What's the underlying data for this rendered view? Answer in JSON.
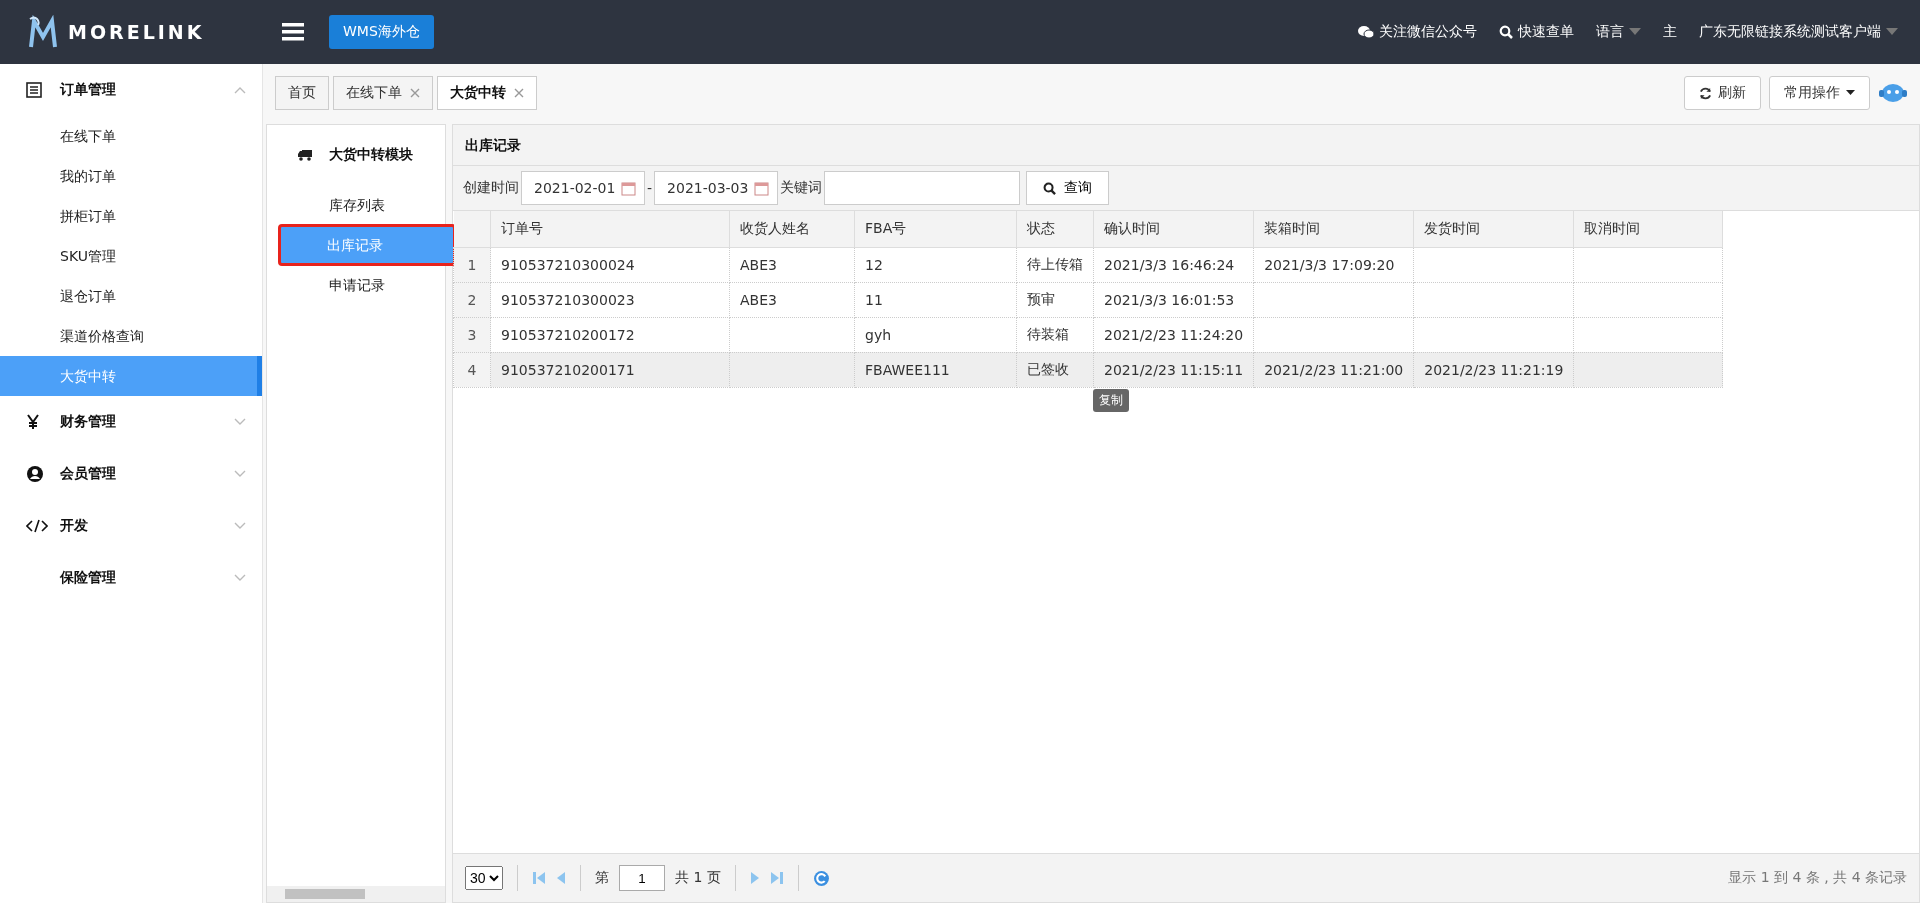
{
  "topbar": {
    "logo": "MORELINK",
    "app_button": "WMS海外仓",
    "links": [
      {
        "kind": "wechat",
        "label": "关注微信公众号"
      },
      {
        "kind": "search",
        "label": "快速查单"
      },
      {
        "kind": "dropdown",
        "label": "语言"
      },
      {
        "kind": "plain",
        "label": "主"
      },
      {
        "kind": "dropdown",
        "label": "广东无限链接系统测试客户端"
      }
    ]
  },
  "sidebar": {
    "groups": [
      {
        "kind": "list",
        "label": "订单管理",
        "expanded": true,
        "children": [
          {
            "label": "在线下单",
            "selected": false
          },
          {
            "label": "我的订单",
            "selected": false
          },
          {
            "label": "拼柜订单",
            "selected": false
          },
          {
            "label": "SKU管理",
            "selected": false
          },
          {
            "label": "退仓订单",
            "selected": false
          },
          {
            "label": "渠道价格查询",
            "selected": false
          },
          {
            "label": "大货中转",
            "selected": true
          }
        ]
      },
      {
        "kind": "finance",
        "label": "财务管理",
        "expanded": false
      },
      {
        "kind": "member",
        "label": "会员管理",
        "expanded": false
      },
      {
        "kind": "code",
        "label": "开发",
        "expanded": false
      },
      {
        "kind": "plain",
        "label": "保险管理",
        "expanded": false
      }
    ]
  },
  "tabs": [
    {
      "label": "首页",
      "selected": false,
      "closable": false
    },
    {
      "label": "在线下单",
      "selected": false,
      "closable": true
    },
    {
      "label": "大货中转",
      "selected": true,
      "closable": true
    }
  ],
  "toolbar": {
    "refresh": "刷新",
    "actions": "常用操作"
  },
  "module": {
    "title": "大货中转模块",
    "items": [
      {
        "label": "库存列表",
        "selected": false,
        "highlighted": false
      },
      {
        "label": "出库记录",
        "selected": true,
        "highlighted": true
      },
      {
        "label": "申请记录",
        "selected": false,
        "highlighted": false
      }
    ]
  },
  "panel": {
    "title": "出库记录",
    "filter": {
      "created_label": "创建时间",
      "date_from": "2021-02-01",
      "date_to": "2021-03-03",
      "separator": "-",
      "keyword_label": "关键词",
      "search_button": "查询"
    },
    "table": {
      "columns": [
        "订单号",
        "收货人姓名",
        "FBA号",
        "状态",
        "确认时间",
        "装箱时间",
        "发货时间",
        "取消时间"
      ],
      "rows": [
        {
          "index": "1",
          "selected": false,
          "cells": [
            "910537210300024",
            "ABE3",
            "12",
            "待上传箱",
            "2021/3/3 16:46:24",
            "2021/3/3 17:09:20",
            "",
            ""
          ]
        },
        {
          "index": "2",
          "selected": false,
          "cells": [
            "910537210300023",
            "ABE3",
            "11",
            "预审",
            "2021/3/3 16:01:53",
            "",
            "",
            ""
          ]
        },
        {
          "index": "3",
          "selected": false,
          "cells": [
            "910537210200172",
            "",
            "gyh",
            "待装箱",
            "2021/2/23 11:24:20",
            "",
            "",
            ""
          ]
        },
        {
          "index": "4",
          "selected": true,
          "cells": [
            "910537210200171",
            "",
            "FBAWEE111",
            "已签收",
            "2021/2/23 11:15:11",
            "2021/2/23 11:21:00",
            "2021/2/23 11:21:19",
            ""
          ]
        }
      ]
    },
    "tooltip": "复制",
    "pager": {
      "page_size": "30",
      "page_prefix": "第",
      "page": "1",
      "page_suffix": "共 1 页",
      "summary": "显示 1 到 4 条 , 共 4 条记录"
    }
  }
}
